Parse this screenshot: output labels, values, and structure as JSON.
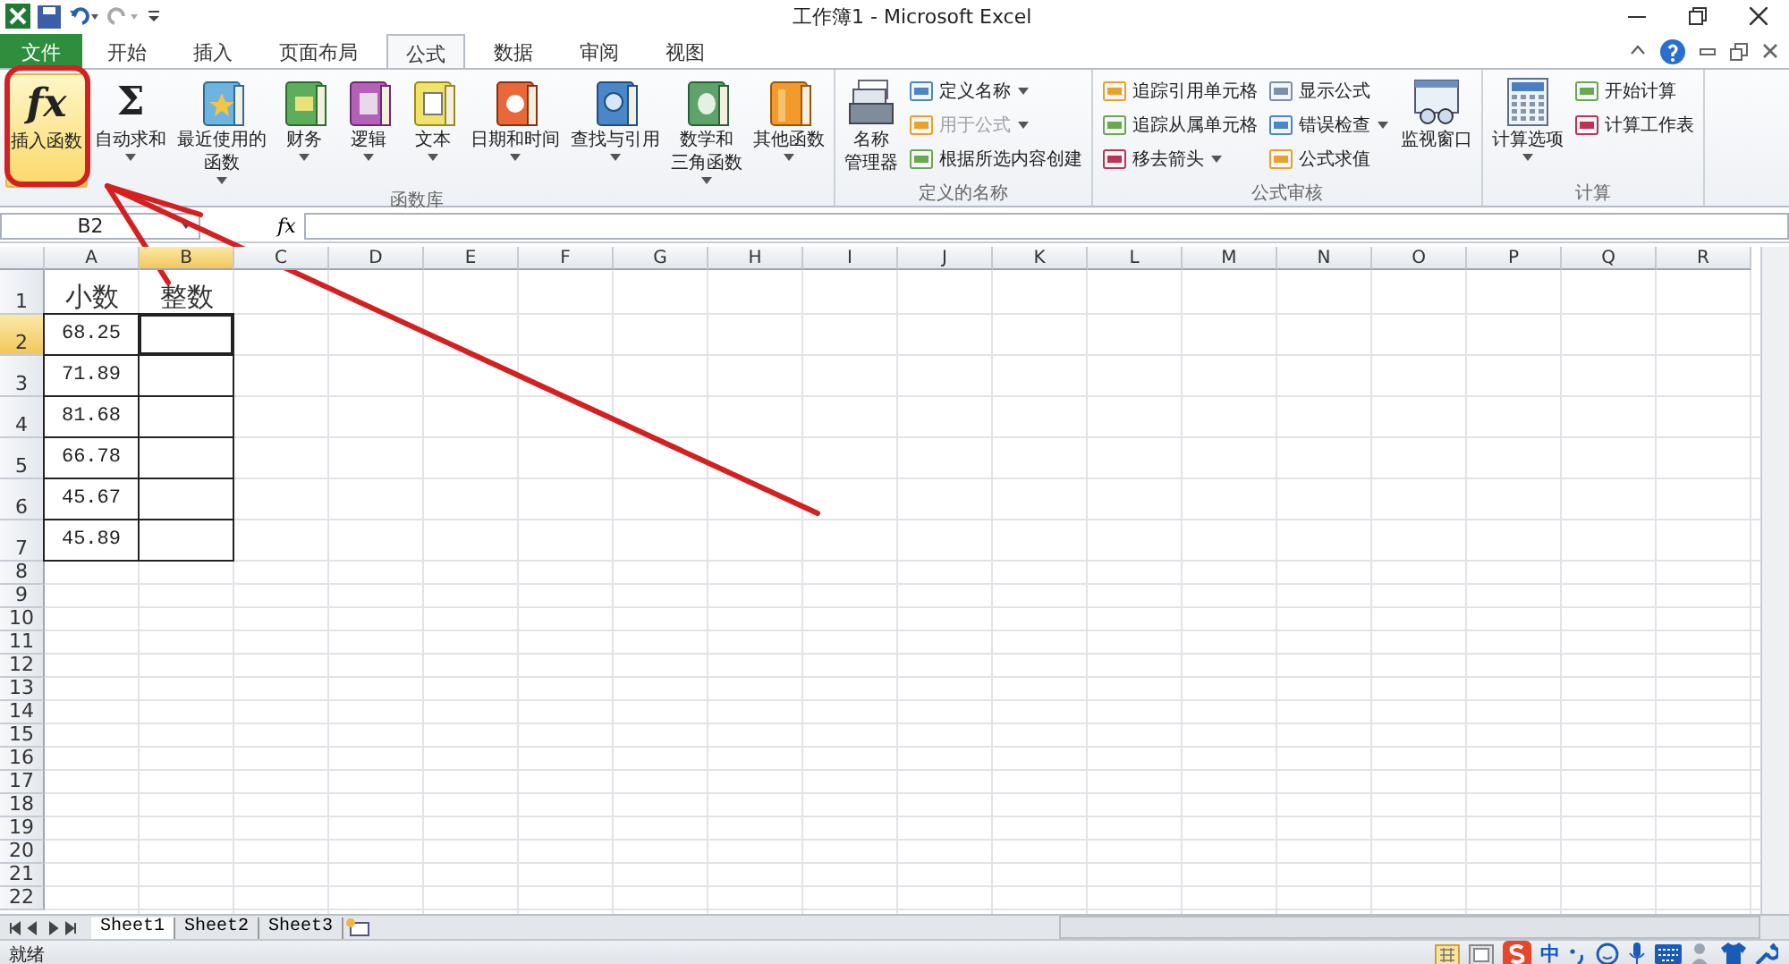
{
  "window": {
    "title": "工作簿1 - Microsoft Excel"
  },
  "tabs": [
    {
      "label": "文件",
      "kind": "file",
      "selected": false
    },
    {
      "label": "开始",
      "kind": "tab",
      "selected": false
    },
    {
      "label": "插入",
      "kind": "tab",
      "selected": false
    },
    {
      "label": "页面布局",
      "kind": "tab",
      "selected": false
    },
    {
      "label": "公式",
      "kind": "tab",
      "selected": true
    },
    {
      "label": "数据",
      "kind": "tab",
      "selected": false
    },
    {
      "label": "审阅",
      "kind": "tab",
      "selected": false
    },
    {
      "label": "视图",
      "kind": "tab",
      "selected": false
    }
  ],
  "ribbon": {
    "groups": [
      {
        "label": "函数库",
        "items": [
          {
            "kind": "large",
            "lines": [
              "插入函数"
            ],
            "glyph": "fx",
            "dropdown": false,
            "highlighted": true
          },
          {
            "kind": "large",
            "lines": [
              "自动求和"
            ],
            "glyph": "Σ",
            "dropdown": true,
            "highlighted": false
          },
          {
            "kind": "large",
            "lines": [
              "最近使用的",
              "函数"
            ],
            "dropdown": true,
            "highlighted": false
          },
          {
            "kind": "large",
            "lines": [
              "财务"
            ],
            "dropdown": true,
            "highlighted": false
          },
          {
            "kind": "large",
            "lines": [
              "逻辑"
            ],
            "dropdown": true,
            "highlighted": false
          },
          {
            "kind": "large",
            "lines": [
              "文本"
            ],
            "dropdown": true,
            "highlighted": false
          },
          {
            "kind": "large",
            "lines": [
              "日期和时间"
            ],
            "dropdown": true,
            "highlighted": false
          },
          {
            "kind": "large",
            "lines": [
              "查找与引用"
            ],
            "dropdown": true,
            "highlighted": false
          },
          {
            "kind": "large",
            "lines": [
              "数学和",
              "三角函数"
            ],
            "dropdown": true,
            "highlighted": false
          },
          {
            "kind": "large",
            "lines": [
              "其他函数"
            ],
            "dropdown": true,
            "highlighted": false
          }
        ]
      },
      {
        "label": "定义的名称",
        "items": [
          {
            "kind": "large",
            "lines": [
              "名称",
              "管理器"
            ],
            "dropdown": false,
            "highlighted": false
          },
          {
            "kind": "column",
            "entries": [
              {
                "label": "定义名称",
                "dropdown": true,
                "disabled": false
              },
              {
                "label": "用于公式",
                "dropdown": true,
                "disabled": true
              },
              {
                "label": "根据所选内容创建",
                "dropdown": false,
                "disabled": false
              }
            ]
          }
        ]
      },
      {
        "label": "公式审核",
        "items": [
          {
            "kind": "column",
            "entries": [
              {
                "label": "追踪引用单元格",
                "dropdown": false,
                "disabled": false
              },
              {
                "label": "追踪从属单元格",
                "dropdown": false,
                "disabled": false
              },
              {
                "label": "移去箭头",
                "dropdown": true,
                "disabled": false
              }
            ]
          },
          {
            "kind": "column",
            "entries": [
              {
                "label": "显示公式",
                "dropdown": false,
                "disabled": false
              },
              {
                "label": "错误检查",
                "dropdown": true,
                "disabled": false
              },
              {
                "label": "公式求值",
                "dropdown": false,
                "disabled": false
              }
            ]
          },
          {
            "kind": "large",
            "lines": [
              "监视窗口"
            ],
            "dropdown": false,
            "highlighted": false
          }
        ]
      },
      {
        "label": "计算",
        "items": [
          {
            "kind": "large",
            "lines": [
              "计算选项"
            ],
            "dropdown": true,
            "highlighted": false
          },
          {
            "kind": "column",
            "entries": [
              {
                "label": "开始计算",
                "dropdown": false,
                "disabled": false
              },
              {
                "label": "计算工作表",
                "dropdown": false,
                "disabled": false
              }
            ]
          }
        ]
      }
    ]
  },
  "name_box": {
    "value": "B2"
  },
  "formula_bar": {
    "button": "fx"
  },
  "columns": [
    {
      "label": "A",
      "selected": false
    },
    {
      "label": "B",
      "selected": true
    },
    {
      "label": "C",
      "selected": false
    },
    {
      "label": "D",
      "selected": false
    },
    {
      "label": "E",
      "selected": false
    },
    {
      "label": "F",
      "selected": false
    },
    {
      "label": "G",
      "selected": false
    },
    {
      "label": "H",
      "selected": false
    },
    {
      "label": "I",
      "selected": false
    },
    {
      "label": "J",
      "selected": false
    },
    {
      "label": "K",
      "selected": false
    },
    {
      "label": "L",
      "selected": false
    },
    {
      "label": "M",
      "selected": false
    },
    {
      "label": "N",
      "selected": false
    },
    {
      "label": "O",
      "selected": false
    },
    {
      "label": "P",
      "selected": false
    },
    {
      "label": "Q",
      "selected": false
    },
    {
      "label": "R",
      "selected": false
    }
  ],
  "rows": [
    {
      "header": "1",
      "selected": false,
      "bordered": false,
      "cells": [
        "小数",
        "整数"
      ]
    },
    {
      "header": "2",
      "selected": true,
      "bordered": true,
      "cells": [
        "68.25"
      ]
    },
    {
      "header": "3",
      "selected": false,
      "bordered": true,
      "cells": [
        "71.89"
      ]
    },
    {
      "header": "4",
      "selected": false,
      "bordered": true,
      "cells": [
        "81.68"
      ]
    },
    {
      "header": "5",
      "selected": false,
      "bordered": true,
      "cells": [
        "66.78"
      ]
    },
    {
      "header": "6",
      "selected": false,
      "bordered": true,
      "cells": [
        "45.67"
      ]
    },
    {
      "header": "7",
      "selected": false,
      "bordered": true,
      "cells": [
        "45.89"
      ]
    },
    {
      "header": "8",
      "selected": false,
      "bordered": false
    },
    {
      "header": "9",
      "selected": false,
      "bordered": false
    },
    {
      "header": "10",
      "selected": false,
      "bordered": false
    },
    {
      "header": "11",
      "selected": false,
      "bordered": false
    },
    {
      "header": "12",
      "selected": false,
      "bordered": false
    },
    {
      "header": "13",
      "selected": false,
      "bordered": false
    },
    {
      "header": "14",
      "selected": false,
      "bordered": false
    },
    {
      "header": "15",
      "selected": false,
      "bordered": false
    },
    {
      "header": "16",
      "selected": false,
      "bordered": false
    },
    {
      "header": "17",
      "selected": false,
      "bordered": false
    },
    {
      "header": "18",
      "selected": false,
      "bordered": false
    },
    {
      "header": "19",
      "selected": false,
      "bordered": false
    },
    {
      "header": "20",
      "selected": false,
      "bordered": false
    },
    {
      "header": "21",
      "selected": false,
      "bordered": false
    },
    {
      "header": "22",
      "selected": false,
      "bordered": false
    }
  ],
  "sheet_tabs": [
    {
      "label": "Sheet1",
      "selected": true
    },
    {
      "label": "Sheet2",
      "selected": false
    },
    {
      "label": "Sheet3",
      "selected": false
    }
  ],
  "status_bar": {
    "text": "就绪",
    "ime": "中"
  }
}
